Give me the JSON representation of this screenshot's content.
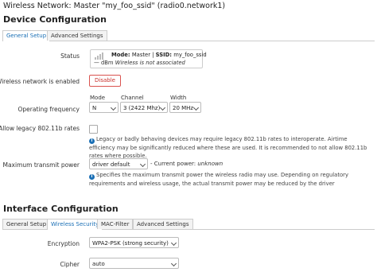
{
  "header": {
    "title": "Wireless Network: Master \"my_foo_ssid\" (radio0.network1)"
  },
  "device_config": {
    "title": "Device Configuration",
    "tabs": [
      {
        "label": "General Setup",
        "active": true
      },
      {
        "label": "Advanced Settings",
        "active": false
      }
    ],
    "status": {
      "label": "Status",
      "mode_prefix": "Mode:",
      "mode_value": "Master",
      "ssid_prefix": "SSID:",
      "ssid_value": "my_foo_ssid",
      "dbm": "— dBm",
      "state": "Wireless is not associated"
    },
    "enabled": {
      "label": "Wireless network is enabled",
      "button": "Disable"
    },
    "frequency": {
      "label": "Operating frequency",
      "mode_label": "Mode",
      "mode_value": "N",
      "channel_label": "Channel",
      "channel_value": "3 (2422 Mhz)",
      "width_label": "Width",
      "width_value": "20 MHz"
    },
    "legacy": {
      "label": "Allow legacy 802.11b rates",
      "checked": false,
      "help": "Legacy or badly behaving devices may require legacy 802.11b rates to interoperate. Airtime efficiency may be significantly reduced where these are used. It is recommended to not allow 802.11b rates where possible."
    },
    "txpower": {
      "label": "Maximum transmit power",
      "value": "driver default",
      "current_prefix": "- Current power:",
      "current_value": "unknown",
      "help": "Specifies the maximum transmit power the wireless radio may use. Depending on regulatory requirements and wireless usage, the actual transmit power may be reduced by the driver"
    }
  },
  "interface_config": {
    "title": "Interface Configuration",
    "tabs": [
      {
        "label": "General Setup",
        "active": false
      },
      {
        "label": "Wireless Security",
        "active": true
      },
      {
        "label": "MAC-Filter",
        "active": false
      },
      {
        "label": "Advanced Settings",
        "active": false
      }
    ],
    "encryption": {
      "label": "Encryption",
      "value": "WPA2-PSK (strong security)"
    },
    "cipher": {
      "label": "Cipher",
      "value": "auto"
    }
  },
  "icons": {
    "signal": "signal-strength-icon",
    "info": "info-icon",
    "caret": "chevron-down-icon"
  },
  "colors": {
    "accent": "#1a6fb5",
    "danger": "#d9534f"
  }
}
